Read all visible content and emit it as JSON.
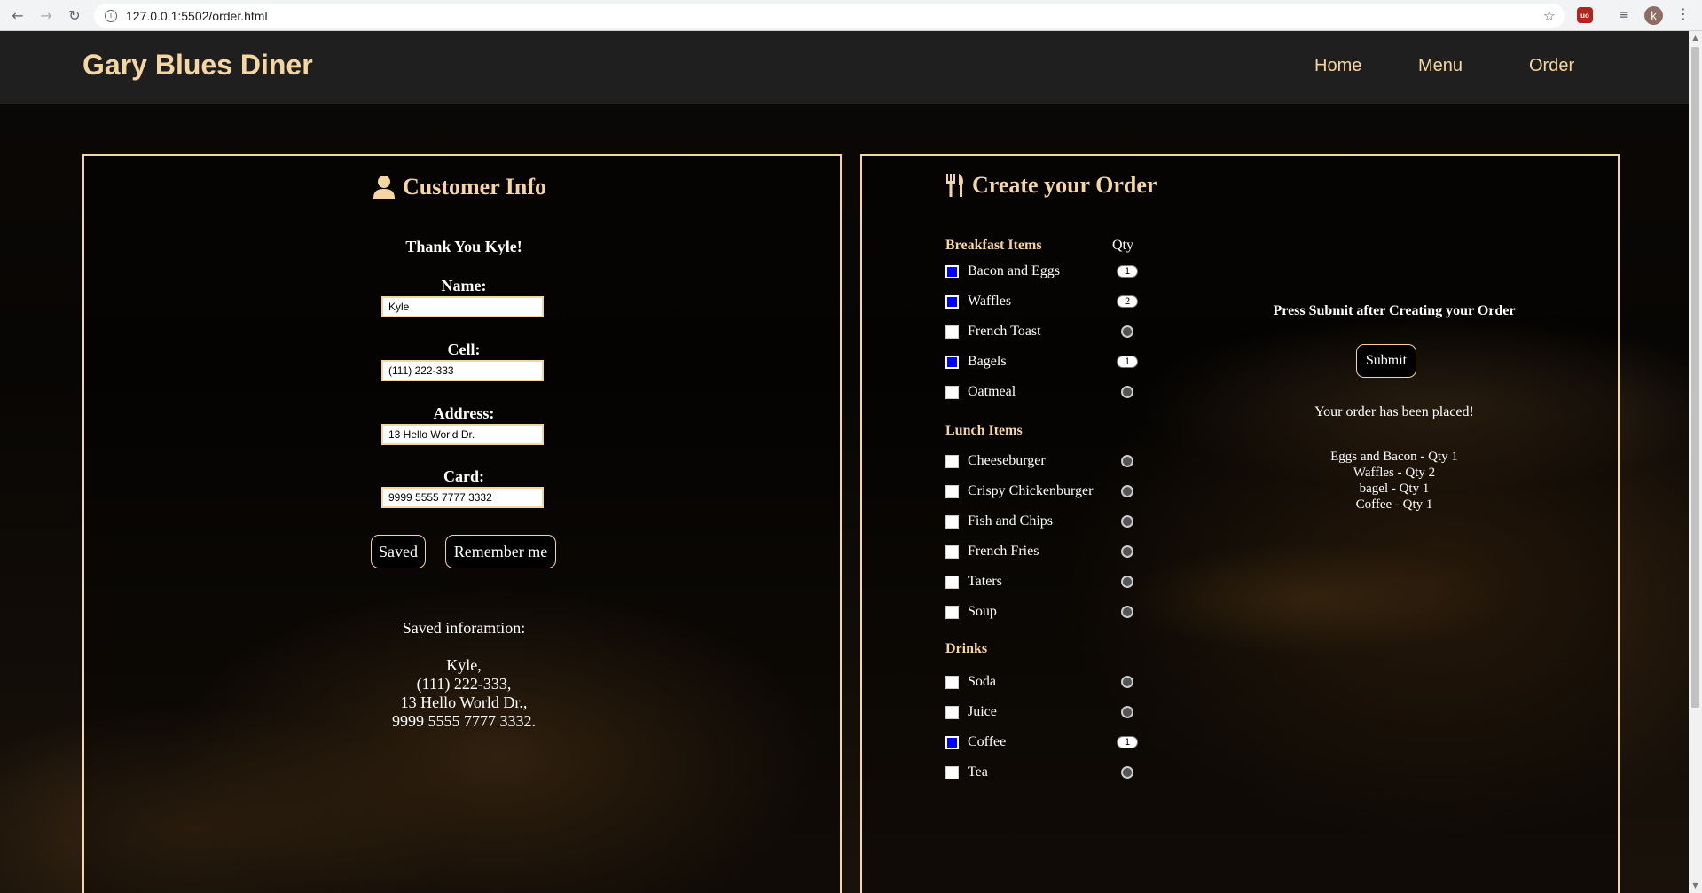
{
  "browser": {
    "url": "127.0.0.1:5502/order.html",
    "avatar_letter": "k",
    "extension_label": "uo"
  },
  "header": {
    "brand": "Gary Blues Diner",
    "nav": [
      "Home",
      "Menu",
      "Order"
    ]
  },
  "customer_info": {
    "title": "Customer Info",
    "thank_you": "Thank You Kyle!",
    "fields": [
      {
        "label": "Name:",
        "value": "Kyle"
      },
      {
        "label": "Cell:",
        "value": "(111) 222-333"
      },
      {
        "label": "Address:",
        "value": "13 Hello World Dr."
      },
      {
        "label": "Card:",
        "value": "9999 5555 7777 3332"
      }
    ],
    "saved_button": "Saved",
    "remember_button": "Remember me",
    "saved_heading": "Saved inforamtion:",
    "saved_lines": [
      "Kyle,",
      "(111) 222-333,",
      "13 Hello World Dr.,",
      "9999 5555 7777 3332."
    ]
  },
  "order": {
    "title": "Create your Order",
    "qty_header": "Qty",
    "sections": [
      {
        "heading": "Breakfast Items",
        "items": [
          {
            "label": "Bacon and Eggs",
            "checked": true,
            "qty": "1"
          },
          {
            "label": "Waffles",
            "checked": true,
            "qty": "2"
          },
          {
            "label": "French Toast",
            "checked": false,
            "qty": ""
          },
          {
            "label": "Bagels",
            "checked": true,
            "qty": "1"
          },
          {
            "label": "Oatmeal",
            "checked": false,
            "qty": ""
          }
        ]
      },
      {
        "heading": "Lunch Items",
        "items": [
          {
            "label": "Cheeseburger",
            "checked": false,
            "qty": ""
          },
          {
            "label": "Crispy Chickenburger",
            "checked": false,
            "qty": ""
          },
          {
            "label": "Fish and Chips",
            "checked": false,
            "qty": ""
          },
          {
            "label": "French Fries",
            "checked": false,
            "qty": ""
          },
          {
            "label": "Taters",
            "checked": false,
            "qty": ""
          },
          {
            "label": "Soup",
            "checked": false,
            "qty": ""
          }
        ]
      },
      {
        "heading": "Drinks",
        "items": [
          {
            "label": "Soda",
            "checked": false,
            "qty": ""
          },
          {
            "label": "Juice",
            "checked": false,
            "qty": ""
          },
          {
            "label": "Coffee",
            "checked": true,
            "qty": "1"
          },
          {
            "label": "Tea",
            "checked": false,
            "qty": ""
          }
        ]
      }
    ],
    "press_text": "Press Submit after Creating your Order",
    "submit_button": "Submit",
    "placed_text": "Your order has been placed!",
    "summary_lines": [
      "Eggs and Bacon - Qty 1",
      "Waffles - Qty 2",
      "bagel - Qty 1",
      "Coffee - Qty 1"
    ]
  },
  "colors": {
    "accent": "#f5d6a3",
    "header_bg": "#1f1f1f",
    "checked": "#0000ff"
  },
  "icons": {
    "customer": "person-icon",
    "order": "utensils-icon"
  }
}
